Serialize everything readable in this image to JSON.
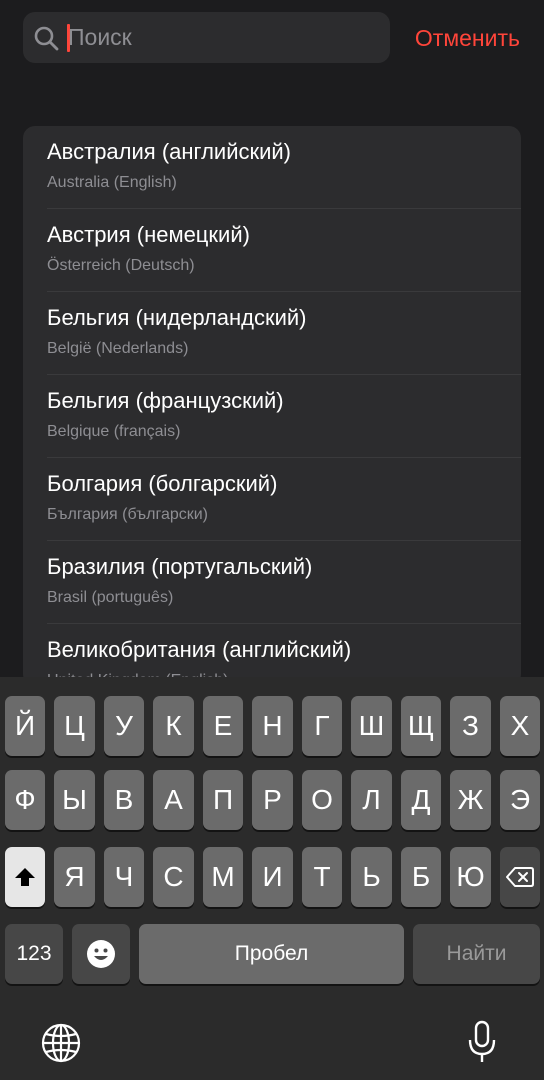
{
  "search": {
    "placeholder": "Поиск",
    "cancel_label": "Отменить"
  },
  "accent_color": "#ff453a",
  "list": {
    "items": [
      {
        "title": "Австралия (английский)",
        "subtitle": "Australia (English)"
      },
      {
        "title": "Австрия (немецкий)",
        "subtitle": "Österreich (Deutsch)"
      },
      {
        "title": "Бельгия (нидерландский)",
        "subtitle": "België (Nederlands)"
      },
      {
        "title": "Бельгия (французский)",
        "subtitle": "Belgique (français)"
      },
      {
        "title": "Болгария (болгарский)",
        "subtitle": "България (български)"
      },
      {
        "title": "Бразилия (португальский)",
        "subtitle": "Brasil (português)"
      },
      {
        "title": "Великобритания (английский)",
        "subtitle": "United Kingdom (English)"
      }
    ]
  },
  "keyboard": {
    "row1": [
      "Й",
      "Ц",
      "У",
      "К",
      "Е",
      "Н",
      "Г",
      "Ш",
      "Щ",
      "З",
      "Х"
    ],
    "row2": [
      "Ф",
      "Ы",
      "В",
      "А",
      "П",
      "Р",
      "О",
      "Л",
      "Д",
      "Ж",
      "Э"
    ],
    "row3": [
      "Я",
      "Ч",
      "С",
      "М",
      "И",
      "Т",
      "Ь",
      "Б",
      "Ю"
    ],
    "numbers_label": "123",
    "space_label": "Пробел",
    "go_label": "Найти",
    "icons": {
      "shift": "shift-icon",
      "delete": "delete-icon",
      "emoji": "emoji-icon",
      "globe": "globe-icon",
      "microphone": "microphone-icon"
    }
  }
}
